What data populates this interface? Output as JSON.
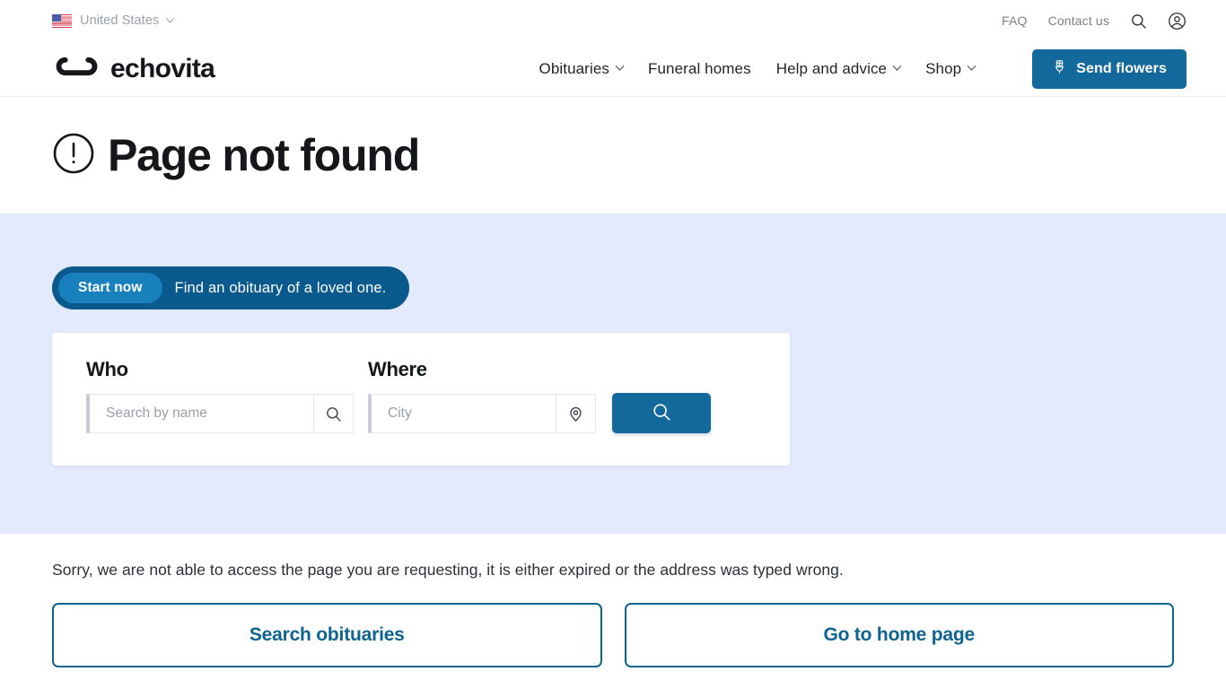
{
  "utility_bar": {
    "country": {
      "name": "United States",
      "flag_icon": "us-flag-icon",
      "chevron_icon": "chevron-down-icon"
    },
    "links": [
      {
        "label": "FAQ",
        "name": "faq-link"
      },
      {
        "label": "Contact us",
        "name": "contact-us-link"
      }
    ],
    "search_icon": "search-icon",
    "account_icon": "account-circle-icon"
  },
  "header": {
    "logo": {
      "text": "echovita",
      "icon": "infinity-logo-icon"
    },
    "nav": [
      {
        "label": "Obituaries",
        "has_chevron": true
      },
      {
        "label": "Funeral homes",
        "has_chevron": false
      },
      {
        "label": "Help and advice",
        "has_chevron": true
      },
      {
        "label": "Shop",
        "has_chevron": true
      }
    ],
    "cta": {
      "label": "Send flowers",
      "icon": "flower-bouquet-icon",
      "color": "#13699b"
    }
  },
  "page": {
    "title": "Page not found",
    "title_icon": "exclamation-circle-icon"
  },
  "hero": {
    "background_color": "#e3eafd",
    "pill": {
      "badge": "Start now",
      "text": "Find an obituary of a loved one.",
      "outer_color": "#0b5a8e",
      "inner_color": "#1780bd"
    },
    "search": {
      "who": {
        "label": "Who",
        "placeholder": "Search by name",
        "value": "",
        "icon": "search-icon"
      },
      "where": {
        "label": "Where",
        "placeholder": "City",
        "value": "",
        "icon": "location-pin-icon"
      },
      "submit": {
        "icon": "search-icon",
        "color": "#13699b"
      }
    }
  },
  "bottom": {
    "message": "Sorry, we are not able to access the page you are requesting, it is either expired or the address was typed wrong.",
    "buttons": [
      {
        "label": "Search obituaries"
      },
      {
        "label": "Go to home page"
      }
    ],
    "accent_color": "#0e6490"
  }
}
